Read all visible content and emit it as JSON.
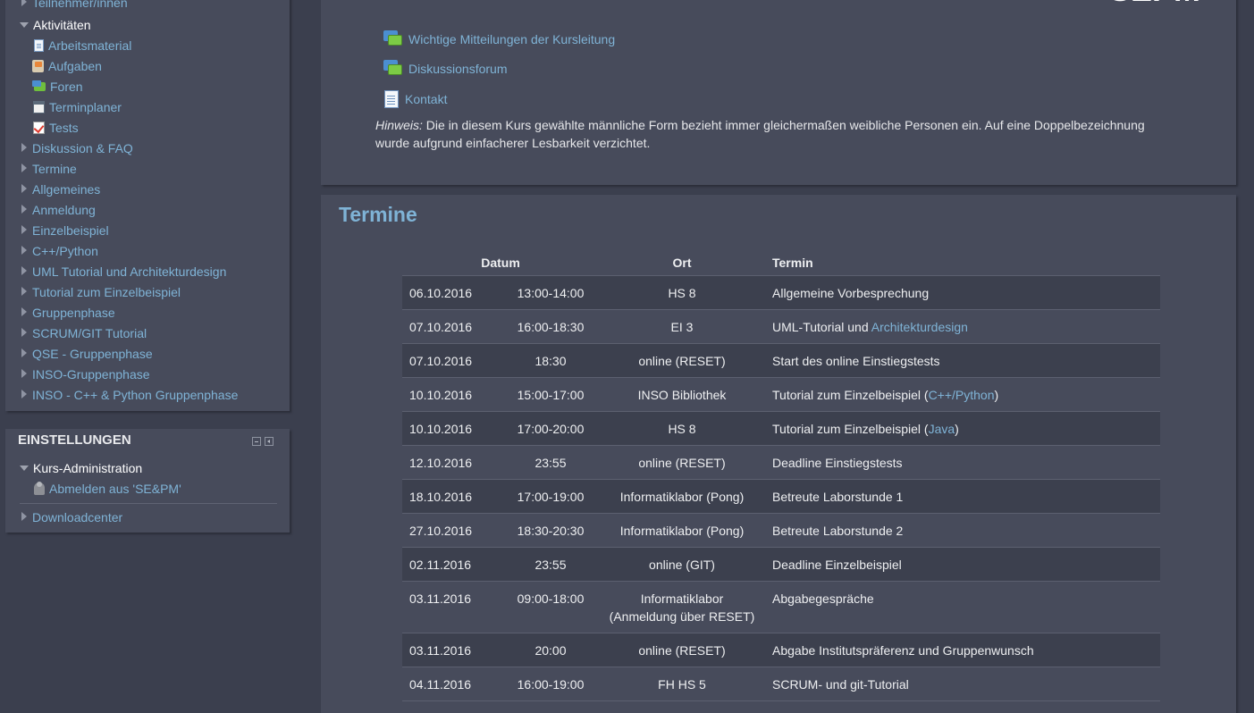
{
  "sidebar": {
    "nav_items": [
      {
        "label": "Teilnehmer/innen",
        "type": "collapsed"
      },
      {
        "label": "Aktivitäten",
        "type": "expanded"
      },
      {
        "label": "Arbeitsmaterial",
        "icon": "document-icon"
      },
      {
        "label": "Aufgaben",
        "icon": "assignment-icon"
      },
      {
        "label": "Foren",
        "icon": "forum-icon"
      },
      {
        "label": "Terminplaner",
        "icon": "calendar-icon"
      },
      {
        "label": "Tests",
        "icon": "quiz-icon"
      },
      {
        "label": "Diskussion & FAQ"
      },
      {
        "label": "Termine"
      },
      {
        "label": "Allgemeines"
      },
      {
        "label": "Anmeldung"
      },
      {
        "label": "Einzelbeispiel"
      },
      {
        "label": "C++/Python"
      },
      {
        "label": "UML Tutorial und Architekturdesign"
      },
      {
        "label": "Tutorial zum Einzelbeispiel"
      },
      {
        "label": "Gruppenphase"
      },
      {
        "label": "SCRUM/GIT Tutorial"
      },
      {
        "label": "QSE - Gruppenphase"
      },
      {
        "label": "INSO-Gruppenphase"
      },
      {
        "label": "INSO - C++ & Python Gruppenphase"
      }
    ],
    "settings": {
      "title": "EINSTELLUNGEN",
      "course_admin": "Kurs-Administration",
      "unenrol": "Abmelden aus 'SE&PM'",
      "downloadcenter": "Downloadcenter"
    }
  },
  "main": {
    "corner_title": "SEPM",
    "links": [
      {
        "label": "Wichtige Mitteilungen der Kursleitung",
        "icon": "forum-icon"
      },
      {
        "label": "Diskussionsforum",
        "icon": "forum-icon"
      },
      {
        "label": "Kontakt",
        "icon": "page-icon"
      }
    ],
    "hint_label": "Hinweis:",
    "hint_text": " Die in diesem Kurs gewählte männliche Form bezieht immer gleichermaßen weibliche Personen ein. Auf eine Doppelbezeichnung wurde aufgrund einfacherer Lesbarkeit verzichtet.",
    "termine": {
      "title": "Termine",
      "headers": {
        "datum": "Datum",
        "ort": "Ort",
        "termin": "Termin"
      },
      "rows": [
        {
          "date": "06.10.2016",
          "time": "13:00-14:00",
          "ort": "HS 8",
          "termin": [
            {
              "t": "Allgemeine Vorbesprechung"
            }
          ]
        },
        {
          "date": "07.10.2016",
          "time": "16:00-18:30",
          "ort": "EI 3",
          "termin": [
            {
              "t": "UML-Tutorial und "
            },
            {
              "t": "Architekturdesign",
              "link": true
            }
          ]
        },
        {
          "date": "07.10.2016",
          "time": "18:30",
          "ort": "online (RESET)",
          "termin": [
            {
              "t": "Start des online Einstiegstests"
            }
          ]
        },
        {
          "date": "10.10.2016",
          "time": "15:00-17:00",
          "ort": "INSO Bibliothek",
          "termin": [
            {
              "t": "Tutorial zum Einzelbeispiel ("
            },
            {
              "t": "C++/Python",
              "link": true
            },
            {
              "t": ")"
            }
          ]
        },
        {
          "date": "10.10.2016",
          "time": "17:00-20:00",
          "ort": "HS 8",
          "termin": [
            {
              "t": "Tutorial zum Einzelbeispiel ("
            },
            {
              "t": "Java",
              "link": true
            },
            {
              "t": ")"
            }
          ]
        },
        {
          "date": "12.10.2016",
          "time": "23:55",
          "ort": "online (RESET)",
          "termin": [
            {
              "t": "Deadline Einstiegstests"
            }
          ]
        },
        {
          "date": "18.10.2016",
          "time": "17:00-19:00",
          "ort": "Informatiklabor (Pong)",
          "termin": [
            {
              "t": "Betreute Laborstunde 1"
            }
          ]
        },
        {
          "date": "27.10.2016",
          "time": "18:30-20:30",
          "ort": "Informatiklabor (Pong)",
          "termin": [
            {
              "t": "Betreute Laborstunde 2"
            }
          ]
        },
        {
          "date": "02.11.2016",
          "time": "23:55",
          "ort": "online (GIT)",
          "termin": [
            {
              "t": "Deadline Einzelbeispiel"
            }
          ]
        },
        {
          "date": "03.11.2016",
          "time": "09:00-18:00",
          "ort": "Informatiklabor (Anmeldung über RESET)",
          "termin": [
            {
              "t": "Abgabegespräche"
            }
          ]
        },
        {
          "date": "03.11.2016",
          "time": "20:00",
          "ort": "online (RESET)",
          "termin": [
            {
              "t": "Abgabe Institutspräferenz und Gruppenwunsch"
            }
          ]
        },
        {
          "date": "04.11.2016",
          "time": "16:00-19:00",
          "ort": "FH HS 5",
          "termin": [
            {
              "t": "SCRUM- und git-Tutorial"
            }
          ]
        }
      ]
    }
  }
}
